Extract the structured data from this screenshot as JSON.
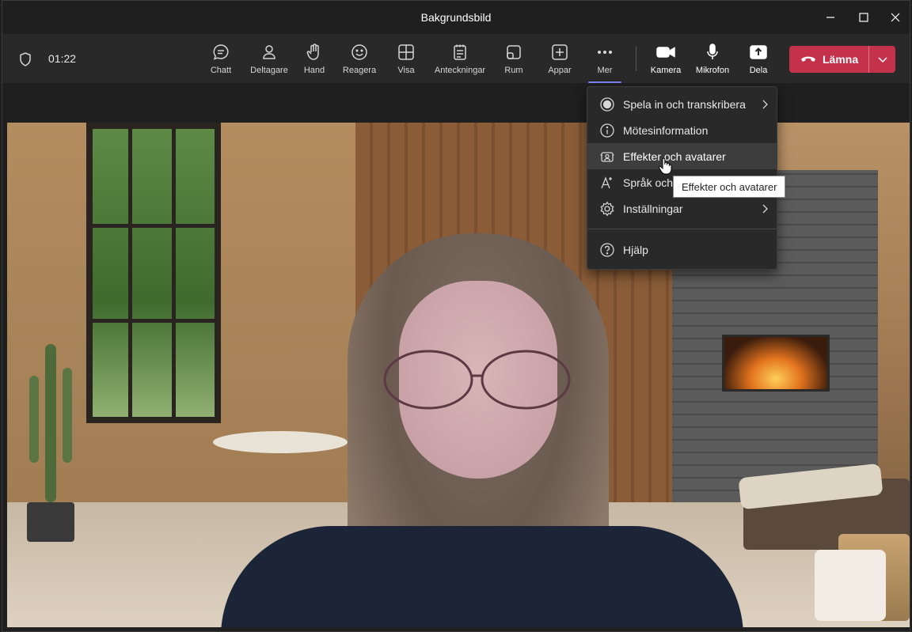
{
  "window": {
    "title": "Bakgrundsbild"
  },
  "toolbar": {
    "timer": "01:22",
    "buttons": [
      {
        "label": "Chatt",
        "icon": "chat-icon"
      },
      {
        "label": "Deltagare",
        "icon": "people-icon"
      },
      {
        "label": "Hand",
        "icon": "hand-icon"
      },
      {
        "label": "Reagera",
        "icon": "smile-icon"
      },
      {
        "label": "Visa",
        "icon": "grid-icon"
      },
      {
        "label": "Anteckningar",
        "icon": "notes-icon"
      },
      {
        "label": "Rum",
        "icon": "rooms-icon"
      },
      {
        "label": "Appar",
        "icon": "plus-box-icon"
      },
      {
        "label": "Mer",
        "icon": "more-dots-icon"
      }
    ],
    "devices": [
      {
        "label": "Kamera",
        "icon": "camera-icon"
      },
      {
        "label": "Mikrofon",
        "icon": "microphone-icon"
      },
      {
        "label": "Dela",
        "icon": "share-icon"
      }
    ],
    "leave_label": "Lämna",
    "leave_color": "#c4314b",
    "active_underline_color": "#7f85f5"
  },
  "menu": {
    "items": [
      {
        "label": "Spela in och transkribera",
        "icon": "record-icon",
        "submenu": true
      },
      {
        "label": "Mötesinformation",
        "icon": "info-icon",
        "submenu": false
      },
      {
        "label": "Effekter och avatarer",
        "icon": "effects-icon",
        "submenu": false,
        "highlighted": true
      },
      {
        "label": "Språk och",
        "icon": "language-icon",
        "submenu": false
      },
      {
        "label": "Inställningar",
        "icon": "gear-icon",
        "submenu": true
      },
      {
        "label": "Hjälp",
        "icon": "help-icon",
        "submenu": false
      }
    ]
  },
  "tooltip": {
    "text": "Effekter och avatarer"
  }
}
